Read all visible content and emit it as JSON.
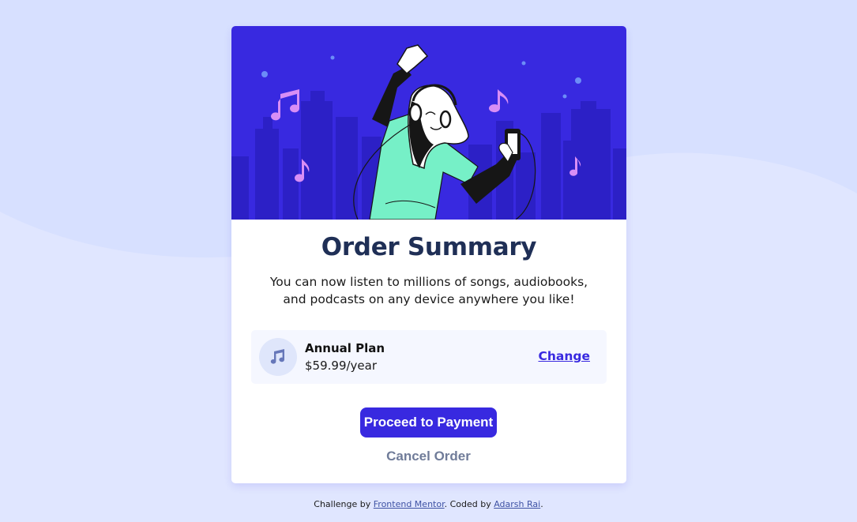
{
  "colors": {
    "page_bg": "#d7e0ff",
    "card_bg": "#ffffff",
    "hero_bg": "#3829e0",
    "bright_blue": "#3829e0",
    "dark_blue": "#1f2f56",
    "desaturated_blue": "#707c99",
    "plan_bg": "#f5f7ff"
  },
  "card": {
    "hero_alt": "illustration-hero",
    "title": "Order Summary",
    "description": "You can now listen to millions of songs, audiobooks, and podcasts on any device anywhere you like!",
    "plan": {
      "icon": "music-note-icon",
      "name": "Annual Plan",
      "price": "$59.99/year",
      "change_label": "Change"
    },
    "proceed_label": "Proceed to Payment",
    "cancel_label": "Cancel Order"
  },
  "attribution": {
    "prefix": "Challenge by ",
    "link1": "Frontend Mentor",
    "middle": ". Coded by ",
    "link2": "Adarsh Rai",
    "suffix": "."
  }
}
